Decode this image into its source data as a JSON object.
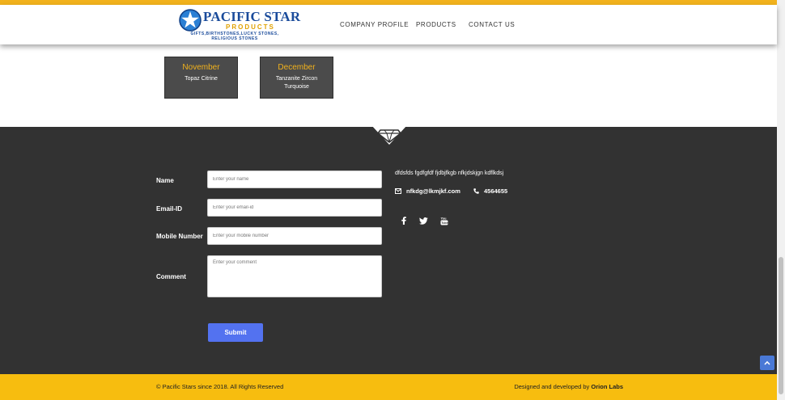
{
  "brand": {
    "name": "PACIFIC STAR",
    "sub": "PRODUCTS",
    "tagline": "GIFTS,BIRTHSTONES,LUCKY STONES, RELIGIOUS STONES"
  },
  "nav": {
    "items": [
      "COMPANY PROFILE",
      "PRODUCTS",
      "CONTACT US"
    ]
  },
  "birthstones": [
    {
      "month": "November",
      "stones": "Topaz Citrine"
    },
    {
      "month": "December",
      "stones": "Tanzanite Zircon Turquoise"
    }
  ],
  "contact_form": {
    "name_label": "Name",
    "name_placeholder": "Enter your name",
    "email_label": "Email-ID",
    "email_placeholder": "Enter your email-id",
    "mobile_label": "Mobile Number",
    "mobile_placeholder": "Enter your mobile number",
    "comment_label": "Comment",
    "comment_placeholder": "Enter your comment",
    "submit_label": "Submit"
  },
  "contact_info": {
    "about": "dfdsfds fgdfgfdf fjdbjfkgb nfkjdskjgn kdflkdsj",
    "email": "nfkdg@lkmjkf.com",
    "phone": "4564655"
  },
  "social": [
    "facebook-icon",
    "twitter-icon",
    "youtube-icon"
  ],
  "footer": {
    "copyright": "© Pacific Stars since 2018. All Rights Reserved",
    "credits_prefix": "Designed and developed by",
    "credits_company": "Orion Labs"
  },
  "colors": {
    "accent_yellow": "#f7bd0f",
    "dark_bg": "#323232",
    "card_bg": "#4b4b4b",
    "month_text": "#f2b21c",
    "submit_blue": "#5372f0",
    "brand_blue": "#1a4b9b"
  }
}
